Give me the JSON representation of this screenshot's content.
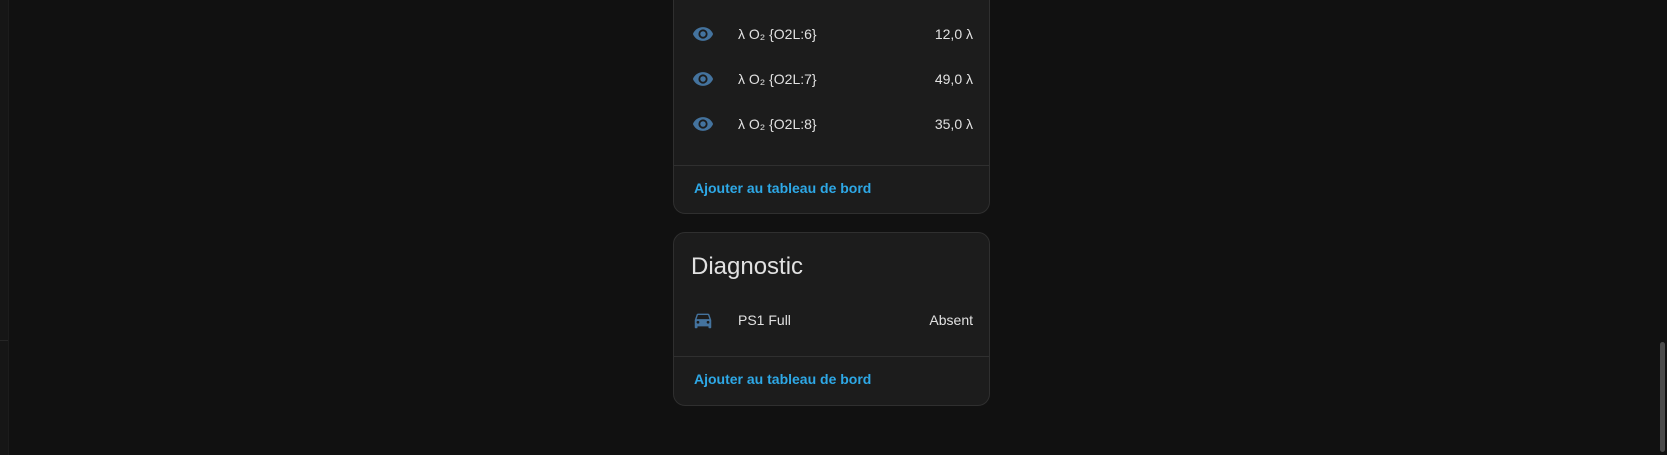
{
  "colors": {
    "background": "#111111",
    "card": "#1c1c1c",
    "icon": "#44739e",
    "accent": "#2ea8e6",
    "text": "#e1e1e1"
  },
  "sensors_card": {
    "rows": [
      {
        "icon": "eye-icon",
        "name": "λ O₂ {O2L:6}",
        "value": "12,0 λ"
      },
      {
        "icon": "eye-icon",
        "name": "λ O₂ {O2L:7}",
        "value": "49,0 λ"
      },
      {
        "icon": "eye-icon",
        "name": "λ O₂ {O2L:8}",
        "value": "35,0 λ"
      }
    ],
    "action_label": "Ajouter au tableau de bord"
  },
  "diagnostic_card": {
    "title": "Diagnostic",
    "rows": [
      {
        "icon": "car-icon",
        "name": "PS1 Full",
        "value": "Absent"
      }
    ],
    "action_label": "Ajouter au tableau de bord"
  }
}
